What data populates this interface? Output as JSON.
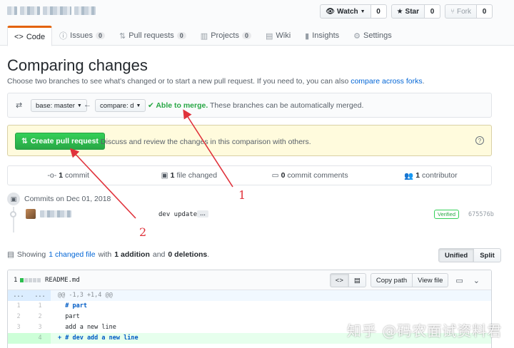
{
  "repo": {
    "title_obscured": ""
  },
  "actions": {
    "watch": {
      "label": "Watch",
      "count": "0"
    },
    "star": {
      "label": "Star",
      "count": "0"
    },
    "fork": {
      "label": "Fork",
      "count": "0"
    }
  },
  "tabs": [
    {
      "label": "Code",
      "count": ""
    },
    {
      "label": "Issues",
      "count": "0"
    },
    {
      "label": "Pull requests",
      "count": "0"
    },
    {
      "label": "Projects",
      "count": "0"
    },
    {
      "label": "Wiki",
      "count": ""
    },
    {
      "label": "Insights",
      "count": ""
    },
    {
      "label": "Settings",
      "count": ""
    }
  ],
  "header": {
    "title": "Comparing changes",
    "subtitle": "Choose two branches to see what's changed or to start a new pull request. If you need to, you can also",
    "subtitle_link": "compare across forks",
    "subtitle_end": "."
  },
  "range": {
    "base": "base: master",
    "compare": "compare: d",
    "merge_ok": "✔ Able to merge.",
    "merge_text": "These branches can be automatically merged."
  },
  "flash": {
    "button": "Create pull request",
    "text": "Discuss and review the changes in this comparison with others."
  },
  "summary": {
    "commits_num": "1",
    "commits_label": "commit",
    "files_num": "1",
    "files_label": "file changed",
    "comments_num": "0",
    "comments_label": "commit comments",
    "contrib_num": "1",
    "contrib_label": "contributor"
  },
  "commits": {
    "heading": "Commits on Dec 01, 2018",
    "message": "dev update",
    "ellipsis": "…",
    "verified": "Verified",
    "sha": "675576b"
  },
  "toc": {
    "prefix": "Showing",
    "link": "1 changed file",
    "with": "with",
    "additions": "1 addition",
    "and": "and",
    "deletions": "0 deletions",
    "end": "."
  },
  "view": {
    "unified": "Unified",
    "split": "Split"
  },
  "file": {
    "count": "1",
    "name": "README.md",
    "copy_path": "Copy path",
    "view_file": "View file",
    "lines": [
      {
        "type": "hunk",
        "old": "...",
        "new": "...",
        "text": "@@ -1,3 +1,4 @@"
      },
      {
        "type": "ctx",
        "old": "1",
        "new": "1",
        "text": "  # part"
      },
      {
        "type": "ctx",
        "old": "2",
        "new": "2",
        "text": "  part"
      },
      {
        "type": "ctx",
        "old": "3",
        "new": "3",
        "text": "  add a new line"
      },
      {
        "type": "add",
        "old": "",
        "new": "4",
        "text": "+ # dev add a new line"
      }
    ]
  },
  "annotations": {
    "one": "1",
    "two": "2"
  },
  "watermark": "知乎 @码农面试资料君",
  "colors": {
    "accent": "#e36209",
    "green": "#28a745",
    "link": "#0366d6",
    "arrow": "#e0323b"
  }
}
